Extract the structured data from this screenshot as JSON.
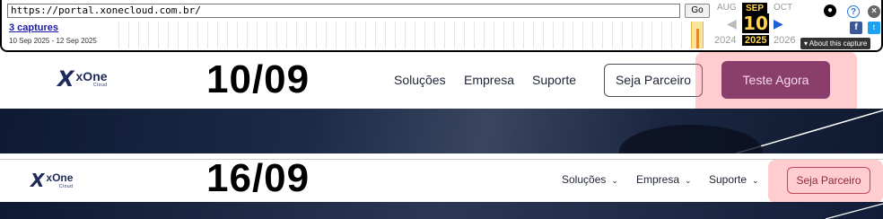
{
  "wayback": {
    "url": "https://portal.xonecloud.com.br/",
    "go_label": "Go",
    "captures_label": "3 captures",
    "date_range": "10 Sep 2025 - 12 Sep 2025",
    "months": {
      "prev": "AUG",
      "cur": "SEP",
      "next": "OCT"
    },
    "day": "10",
    "years": {
      "prev": "2024",
      "cur": "2025",
      "next": "2026"
    },
    "about_label": "About this capture"
  },
  "panel1": {
    "logo_word": "xOne",
    "logo_sub": "Cloud",
    "date": "10/09",
    "nav": [
      "Soluções",
      "Empresa",
      "Suporte"
    ],
    "partner_button": "Seja Parceiro",
    "try_button": "Teste Agora"
  },
  "panel2": {
    "logo_word": "xOne",
    "logo_sub": "Cloud",
    "date": "16/09",
    "nav": [
      "Soluções",
      "Empresa",
      "Suporte"
    ],
    "partner_button": "Seja Parceiro"
  },
  "colors": {
    "brand_navy": "#1e2b5a",
    "cta_purple": "#8a3e6b",
    "highlight": "#ff6e78",
    "wayback_gold": "#ffd34d"
  }
}
